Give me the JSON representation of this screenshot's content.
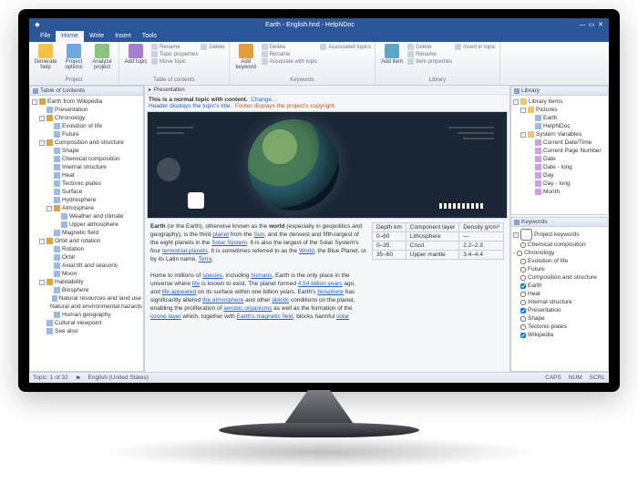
{
  "window": {
    "title": "Earth - English.hnd - HelpNDoc",
    "btns": {
      "min": "—",
      "max": "▭",
      "close": "✕"
    }
  },
  "menu": {
    "file": "File",
    "tabs": [
      "Home",
      "Write",
      "Insert",
      "Tools"
    ],
    "active": "Home"
  },
  "ribbon": {
    "project": {
      "label": "Project",
      "generate": "Generate help",
      "options": "Project options",
      "analyze": "Analyze project"
    },
    "toc": {
      "label": "Table of contents",
      "add": "Add topic",
      "rename": "Rename",
      "properties": "Topic properties",
      "move": "Move topic",
      "delete": "Delete"
    },
    "keywords": {
      "label": "Keywords",
      "add": "Add keyword",
      "delete": "Delete",
      "rename": "Rename",
      "assoc": "Associate with topic",
      "topics": "Associated topics"
    },
    "library": {
      "label": "Library",
      "add": "Add item",
      "delete": "Delete",
      "rename": "Rename",
      "props": "Item properties",
      "insert": "Insert in topic"
    }
  },
  "toc": {
    "title": "Table of contents",
    "items": [
      {
        "l": 0,
        "t": "b",
        "exp": "-",
        "label": "Earth from Wikipedia"
      },
      {
        "l": 1,
        "t": "p",
        "label": "Presentation"
      },
      {
        "l": 1,
        "t": "b",
        "exp": "-",
        "label": "Chronology"
      },
      {
        "l": 2,
        "t": "p",
        "label": "Evolution of life"
      },
      {
        "l": 2,
        "t": "p",
        "label": "Future"
      },
      {
        "l": 1,
        "t": "b",
        "exp": "-",
        "label": "Composition and structure"
      },
      {
        "l": 2,
        "t": "p",
        "label": "Shape"
      },
      {
        "l": 2,
        "t": "p",
        "label": "Chemical composition"
      },
      {
        "l": 2,
        "t": "p",
        "label": "Internal structure"
      },
      {
        "l": 2,
        "t": "p",
        "label": "Heat"
      },
      {
        "l": 2,
        "t": "p",
        "label": "Tectonic plates"
      },
      {
        "l": 2,
        "t": "p",
        "label": "Surface"
      },
      {
        "l": 2,
        "t": "p",
        "label": "Hydrosphere"
      },
      {
        "l": 2,
        "t": "b",
        "exp": "-",
        "label": "Atmosphere"
      },
      {
        "l": 3,
        "t": "p",
        "label": "Weather and climate"
      },
      {
        "l": 3,
        "t": "p",
        "label": "Upper atmosphere"
      },
      {
        "l": 2,
        "t": "p",
        "label": "Magnetic field"
      },
      {
        "l": 1,
        "t": "b",
        "exp": "-",
        "label": "Orbit and rotation"
      },
      {
        "l": 2,
        "t": "p",
        "label": "Rotation"
      },
      {
        "l": 2,
        "t": "p",
        "label": "Orbit"
      },
      {
        "l": 2,
        "t": "p",
        "label": "Axial tilt and seasons"
      },
      {
        "l": 2,
        "t": "p",
        "label": "Moon"
      },
      {
        "l": 1,
        "t": "b",
        "exp": "-",
        "label": "Habitability"
      },
      {
        "l": 2,
        "t": "p",
        "label": "Biosphere"
      },
      {
        "l": 2,
        "t": "p",
        "label": "Natural resources and land use"
      },
      {
        "l": 2,
        "t": "p",
        "label": "Natural and environmental hazards"
      },
      {
        "l": 2,
        "t": "p",
        "label": "Human geography"
      },
      {
        "l": 1,
        "t": "p",
        "label": "Cultural viewpoint"
      },
      {
        "l": 1,
        "t": "p",
        "label": "See also"
      }
    ]
  },
  "content": {
    "breadcrumb": "Presentation",
    "info1a": "This is a normal topic with content.",
    "info1b": "Change…",
    "info2a": "Header displays the topic's title.",
    "info2b": "Footer displays the project's copyright.",
    "para1": [
      {
        "b": "Earth"
      },
      " (or the Earth), otherwise known as the ",
      {
        "b": "world"
      },
      " (especially in geopolitics and geography), is the third ",
      {
        "a": "planet"
      },
      " from the ",
      {
        "a": "Sun"
      },
      ", and the densest and fifth-largest of the eight planets in the ",
      {
        "a": "Solar System"
      },
      ". It is also the largest of the Solar System's four ",
      {
        "a": "terrestrial planets"
      },
      ". It is sometimes referred to as the ",
      {
        "a": "World"
      },
      ", the Blue Planet, or by its Latin name, ",
      {
        "a": "Terra"
      },
      "."
    ],
    "para2": [
      "Home to millions of ",
      {
        "a": "species"
      },
      ", including ",
      {
        "a": "humans"
      },
      ", Earth is the only place in the universe where ",
      {
        "a": "life"
      },
      " is known to exist. The planet formed ",
      {
        "a": "4.54 billion years"
      },
      " ago, and ",
      {
        "a": "life appeared"
      },
      " on its surface within one billion years. Earth's ",
      {
        "a": "biosphere"
      },
      " has significantly altered ",
      {
        "a": "the atmosphere"
      },
      " and other ",
      {
        "a": "abiotic"
      },
      " conditions on the planet, enabling the proliferation of ",
      {
        "a": "aerobic organisms"
      },
      " as well as the formation of the ",
      {
        "a": "ozone layer"
      },
      " which, together with ",
      {
        "a": "Earth's magnetic field"
      },
      ", blocks harmful ",
      {
        "a": "solar"
      }
    ],
    "table": {
      "headers": [
        "Depth km",
        "Component layer",
        "Density g/cm³"
      ],
      "rows": [
        [
          "0–60",
          "Lithosphere",
          "—"
        ],
        [
          "0–35",
          "Crust",
          "2.2–2.9"
        ],
        [
          "35–60",
          "Upper mantle",
          "3.4–4.4"
        ]
      ]
    }
  },
  "library": {
    "title": "Library",
    "items": [
      {
        "l": 0,
        "t": "folder",
        "exp": "-",
        "label": "Library items"
      },
      {
        "l": 1,
        "t": "folder",
        "exp": "-",
        "label": "Pictures"
      },
      {
        "l": 2,
        "t": "page",
        "label": "Earth"
      },
      {
        "l": 2,
        "t": "page",
        "label": "HelpNDoc"
      },
      {
        "l": 1,
        "t": "folder",
        "exp": "-",
        "label": "System Variables"
      },
      {
        "l": 2,
        "t": "var",
        "label": "Current Date/Time"
      },
      {
        "l": 2,
        "t": "var",
        "label": "Current Page Number"
      },
      {
        "l": 2,
        "t": "var",
        "label": "Date"
      },
      {
        "l": 2,
        "t": "var",
        "label": "Date - long"
      },
      {
        "l": 2,
        "t": "var",
        "label": "Day"
      },
      {
        "l": 2,
        "t": "var",
        "label": "Day - long"
      },
      {
        "l": 2,
        "t": "var",
        "label": "Month"
      }
    ]
  },
  "keywords": {
    "title": "Keywords",
    "root": "Project keywords",
    "items": [
      {
        "l": 1,
        "chk": false,
        "label": "Chemical composition"
      },
      {
        "l": 1,
        "chk": false,
        "exp": "-",
        "label": "Chronology"
      },
      {
        "l": 2,
        "chk": false,
        "label": "Evolution of life"
      },
      {
        "l": 2,
        "chk": false,
        "label": "Future"
      },
      {
        "l": 1,
        "chk": false,
        "label": "Composition and structure"
      },
      {
        "l": 1,
        "chk": true,
        "label": "Earth"
      },
      {
        "l": 1,
        "chk": false,
        "label": "Heat"
      },
      {
        "l": 1,
        "chk": false,
        "label": "Internal structure"
      },
      {
        "l": 1,
        "chk": true,
        "label": "Presentation"
      },
      {
        "l": 1,
        "chk": false,
        "label": "Shape"
      },
      {
        "l": 1,
        "chk": false,
        "label": "Tectonic plates"
      },
      {
        "l": 1,
        "chk": true,
        "label": "Wikipedia"
      }
    ]
  },
  "status": {
    "topic": "Topic: 1 of 32",
    "lang": "English (United States)",
    "caps": "CAPS",
    "num": "NUM",
    "scrl": "SCRL"
  },
  "colors": {
    "accent": "#2b579a"
  }
}
